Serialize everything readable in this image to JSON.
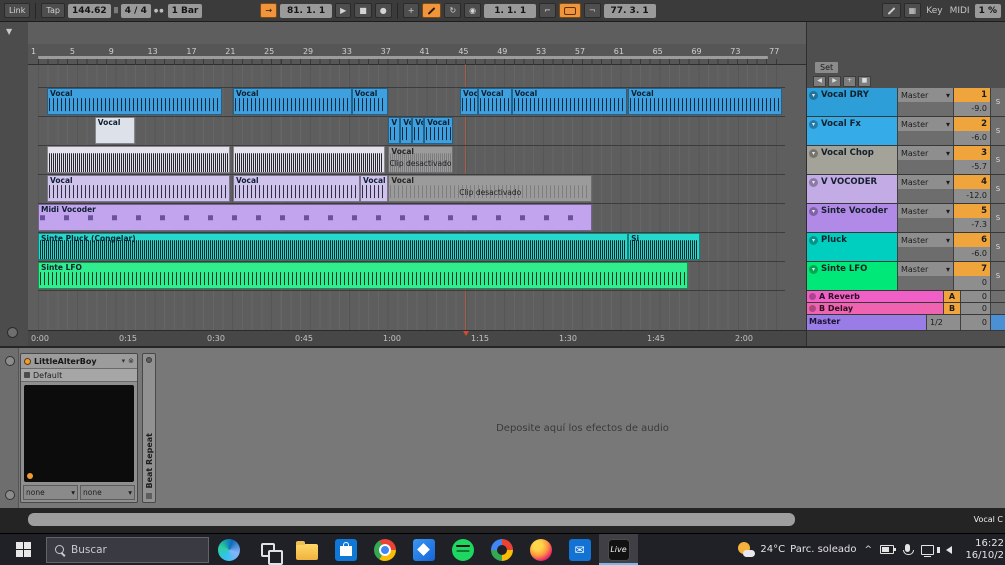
{
  "transport": {
    "link_label": "Link",
    "tap_label": "Tap",
    "tempo": "144.62",
    "time_signature": "4 / 4",
    "quantization": "1 Bar",
    "arrangement_position": "81. 1. 1",
    "loop_start": "1. 1. 1",
    "loop_length": "77. 3. 1",
    "key_label": "Key",
    "midi_label": "MIDI",
    "cpu_load": "1 %"
  },
  "arrangement": {
    "bar_numbers": [
      "1",
      "5",
      "9",
      "13",
      "17",
      "21",
      "25",
      "29",
      "33",
      "37",
      "41",
      "45",
      "49",
      "53",
      "57",
      "61",
      "65",
      "69",
      "73",
      "77"
    ],
    "time_labels": [
      "0:00",
      "0:15",
      "0:30",
      "0:45",
      "1:00",
      "1:15",
      "1:30",
      "1:45",
      "2:00"
    ],
    "lanes": [
      {
        "name": "Vocal DRY",
        "color": "#3fa0e0",
        "wave": "wave",
        "clips": [
          {
            "label": "Vocal",
            "left": 1.2,
            "width": 23.4
          },
          {
            "label": "Vocal",
            "left": 26.1,
            "width": 15.9
          },
          {
            "label": "Vocal",
            "left": 42.0,
            "width": 4.8
          },
          {
            "label": "Vocal",
            "left": 56.5,
            "width": 2.4
          },
          {
            "label": "Vocal",
            "left": 58.9,
            "width": 4.5
          },
          {
            "label": "Vocal",
            "left": 63.4,
            "width": 15.5
          },
          {
            "label": "Vocal",
            "left": 79.0,
            "width": 20.6
          }
        ]
      },
      {
        "name": "Vocal Fx",
        "color": "#3fa0e0",
        "wave": "wave",
        "clips": [
          {
            "label": "Vocal",
            "left": 7.6,
            "width": 5.4,
            "type": "empty"
          },
          {
            "label": "V",
            "left": 46.9,
            "width": 1.6
          },
          {
            "label": "Vo",
            "left": 48.5,
            "width": 1.6
          },
          {
            "label": "Vo",
            "left": 50.1,
            "width": 1.6
          },
          {
            "label": "Vocal",
            "left": 51.7,
            "width": 3.8
          }
        ]
      },
      {
        "name": "Vocal Chop",
        "color": "#e4e0ec",
        "wave": "dense",
        "clips": [
          {
            "label": "",
            "left": 1.2,
            "width": 24.5
          },
          {
            "label": "",
            "left": 26.1,
            "width": 20.4
          },
          {
            "label": "Vocal",
            "left": 46.9,
            "width": 8.6,
            "type": "disabled",
            "sub": "Clip desactivado"
          }
        ]
      },
      {
        "name": "V VOCODER",
        "color": "#cfc2ec",
        "wave": "wave",
        "clips": [
          {
            "label": "Vocal",
            "left": 1.2,
            "width": 24.5
          },
          {
            "label": "Vocal",
            "left": 26.1,
            "width": 17.0
          },
          {
            "label": "Vocal",
            "left": 43.1,
            "width": 3.8
          },
          {
            "label": "Vocal",
            "left": 46.9,
            "width": 27.3,
            "type": "disabled",
            "sub": "Clip desactivado"
          }
        ]
      },
      {
        "name": "Sinte Vocoder",
        "color": "#c2a4ee",
        "wave": "midi",
        "clips": [
          {
            "label": "Midi Vocoder",
            "left": 0,
            "width": 74.2
          }
        ]
      },
      {
        "name": "Pluck",
        "color": "#27d8cc",
        "wave": "dense",
        "clips": [
          {
            "label": "Sinte Pluck (Congelar)",
            "left": 0,
            "width": 79.0
          },
          {
            "label": "Si",
            "left": 79.0,
            "width": 9.6
          }
        ]
      },
      {
        "name": "Sinte LFO",
        "color": "#30ee8e",
        "wave": "wave",
        "clips": [
          {
            "label": "Sinte LFO",
            "left": 0,
            "width": 87.0
          }
        ]
      }
    ]
  },
  "track_panel": {
    "set_label": "Set",
    "tracks": [
      {
        "name": "Vocal DRY",
        "routing": "Master",
        "num": "1",
        "vol": "-9.0",
        "solo": "S",
        "color": "#2e9ed8"
      },
      {
        "name": "Vocal Fx",
        "routing": "Master",
        "num": "2",
        "vol": "-6.0",
        "solo": "S",
        "color": "#35ace8"
      },
      {
        "name": "Vocal Chop",
        "routing": "Master",
        "num": "3",
        "vol": "-5.7",
        "solo": "S",
        "color": "#a3a399"
      },
      {
        "name": "V VOCODER",
        "routing": "Master",
        "num": "4",
        "vol": "-12.0",
        "solo": "S",
        "color": "#c3abe6"
      },
      {
        "name": "Sinte Vocoder",
        "routing": "Master",
        "num": "5",
        "vol": "-7.3",
        "solo": "S",
        "color": "#b18ae8"
      },
      {
        "name": "Pluck",
        "routing": "Master",
        "num": "6",
        "vol": "-6.0",
        "solo": "S",
        "color": "#00cfc0"
      },
      {
        "name": "Sinte LFO",
        "routing": "Master",
        "num": "7",
        "vol": "0",
        "solo": "S",
        "color": "#00e878"
      }
    ],
    "returns": [
      {
        "name": "A Reverb",
        "num": "A",
        "vol": "0",
        "color": "#f05fc5"
      },
      {
        "name": "B Delay",
        "num": "B",
        "vol": "0",
        "color": "#f063b0"
      }
    ],
    "master": {
      "name": "Master",
      "routing": "1/2",
      "vol": "0",
      "color": "#9a7ce6"
    }
  },
  "device_panel": {
    "device_title": "LittleAlterBoy",
    "preset_name": "Default",
    "param_left": "none",
    "param_right": "none",
    "collapsed_device": "Beat Repeat",
    "drop_hint": "Deposite aquí los efectos de audio"
  },
  "status_bar": {
    "clip_name": "Vocal C"
  },
  "taskbar": {
    "search_placeholder": "Buscar",
    "icons": [
      {
        "name": "edge"
      },
      {
        "name": "task-view"
      },
      {
        "name": "file-explorer"
      },
      {
        "name": "store"
      },
      {
        "name": "chrome"
      },
      {
        "name": "photos"
      },
      {
        "name": "spotify"
      },
      {
        "name": "google"
      },
      {
        "name": "firefox"
      },
      {
        "name": "mail"
      },
      {
        "name": "ableton-live",
        "label": "Live",
        "active": true
      }
    ],
    "weather_temp": "24°C",
    "weather_desc": "Parc. soleado",
    "clock_time": "16:22",
    "clock_date": "16/10/2"
  }
}
